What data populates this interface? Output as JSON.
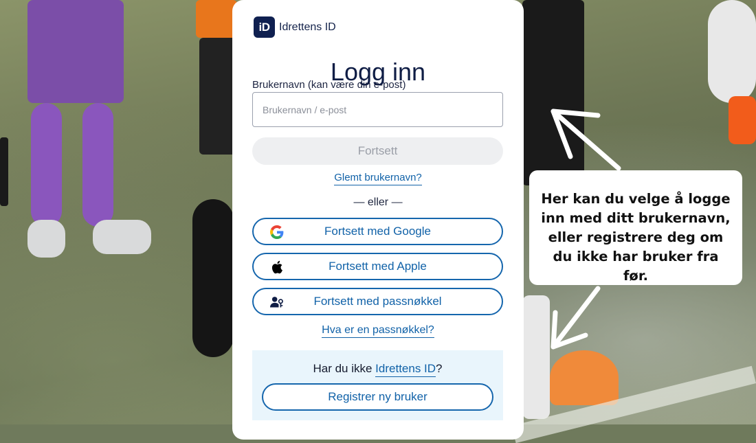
{
  "brand": {
    "logo_text": "iD",
    "name": "Idrettens ID"
  },
  "login": {
    "title": "Logg inn",
    "username_label": "Brukernavn (kan være din e-post)",
    "username_placeholder": "Brukernavn / e-post",
    "username_value": "",
    "continue_label": "Fortsett",
    "forgot_label": "Glemt brukernavn?",
    "divider": "— eller —",
    "providers": [
      {
        "label": "Fortsett med Google",
        "icon": "google-icon"
      },
      {
        "label": "Fortsett med Apple",
        "icon": "apple-icon"
      },
      {
        "label": "Fortsett med passnøkkel",
        "icon": "passkey-icon"
      }
    ],
    "passkey_help": "Hva er en passnøkkel?",
    "register_prompt_prefix": "Har du ikke ",
    "register_prompt_link": "Idrettens ID",
    "register_prompt_suffix": "?",
    "register_label": "Registrer ny bruker"
  },
  "callout": {
    "text": "Her kan du velge å logge inn med ditt brukernavn, eller registrere deg om du ikke har bruker fra før."
  },
  "colors": {
    "primary": "#1162a8",
    "brand_dark": "#0f2050",
    "register_bg": "#e9f5fc",
    "disabled_bg": "#eeeff1"
  }
}
